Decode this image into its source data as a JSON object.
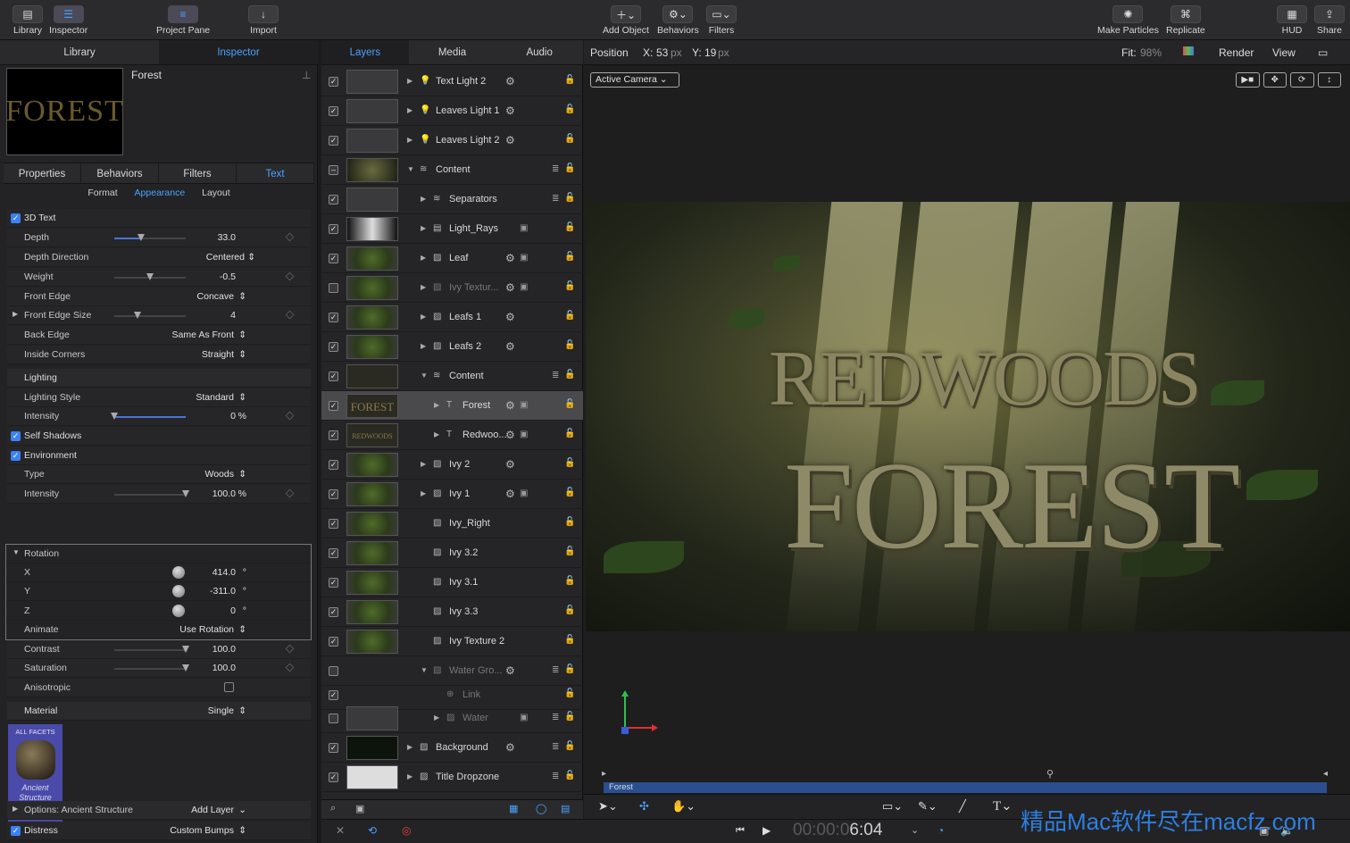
{
  "toolbar": {
    "library": "Library",
    "inspector": "Inspector",
    "project_pane": "Project Pane",
    "import": "Import",
    "add_object": "Add Object",
    "behaviors": "Behaviors",
    "filters": "Filters",
    "make_particles": "Make Particles",
    "replicate": "Replicate",
    "hud": "HUD",
    "share": "Share"
  },
  "left": {
    "tabs": [
      "Library",
      "Inspector"
    ],
    "object_name": "Forest",
    "thumb_text": "FOREST",
    "subtabs": [
      "Properties",
      "Behaviors",
      "Filters",
      "Text"
    ],
    "format_tabs": [
      "Format",
      "Appearance",
      "Layout"
    ],
    "rows": {
      "three_d_text": "3D Text",
      "depth": "Depth",
      "depth_val": "33.0",
      "depth_dir": "Depth Direction",
      "depth_dir_val": "Centered",
      "weight": "Weight",
      "weight_val": "-0.5",
      "front_edge": "Front Edge",
      "front_edge_val": "Concave",
      "front_edge_size": "Front Edge Size",
      "front_edge_size_val": "4",
      "back_edge": "Back Edge",
      "back_edge_val": "Same As Front",
      "inside_corners": "Inside Corners",
      "inside_corners_val": "Straight",
      "lighting": "Lighting",
      "lighting_style": "Lighting Style",
      "lighting_style_val": "Standard",
      "intensity": "Intensity",
      "intensity_val": "0",
      "percent": "%",
      "self_shadows": "Self Shadows",
      "environment": "Environment",
      "type": "Type",
      "type_val": "Woods",
      "env_intensity": "Intensity",
      "env_intensity_val": "100.0",
      "rotation": "Rotation",
      "x": "X",
      "x_val": "414.0",
      "y": "Y",
      "y_val": "-311.0",
      "z": "Z",
      "z_val": "0",
      "degree": "°",
      "animate": "Animate",
      "animate_val": "Use Rotation",
      "contrast": "Contrast",
      "contrast_val": "100.0",
      "saturation": "Saturation",
      "saturation_val": "100.0",
      "anisotropic": "Anisotropic",
      "material": "Material",
      "material_val": "Single",
      "all_facets": "ALL FACETS",
      "swatch_name": "Ancient Structure",
      "options": "Options: Ancient Structure",
      "add_layer": "Add Layer",
      "distress": "Distress",
      "distress_val": "Custom Bumps"
    }
  },
  "layers": {
    "tabs": [
      "Layers",
      "Media",
      "Audio"
    ],
    "items": [
      {
        "name": "Text Light 2"
      },
      {
        "name": "Leaves Light 1"
      },
      {
        "name": "Leaves Light 2"
      },
      {
        "name": "Content"
      },
      {
        "name": "Separators"
      },
      {
        "name": "Light_Rays"
      },
      {
        "name": "Leaf"
      },
      {
        "name": "Ivy Textur..."
      },
      {
        "name": "Leafs 1"
      },
      {
        "name": "Leafs 2"
      },
      {
        "name": "Content"
      },
      {
        "name": "Forest",
        "thumb": "FOREST"
      },
      {
        "name": "Redwoo...",
        "thumb": "REDWOODS"
      },
      {
        "name": "Ivy 2"
      },
      {
        "name": "Ivy 1"
      },
      {
        "name": "Ivy_Right"
      },
      {
        "name": "Ivy 3.2"
      },
      {
        "name": "Ivy 3.1"
      },
      {
        "name": "Ivy 3.3"
      },
      {
        "name": "Ivy Texture 2"
      },
      {
        "name": "Water Gro..."
      },
      {
        "name": "Link"
      },
      {
        "name": "Water"
      },
      {
        "name": "Background"
      },
      {
        "name": "Title Dropzone"
      }
    ]
  },
  "viewer": {
    "position_label": "Position",
    "x_label": "X:",
    "x_val": "53",
    "y_label": "Y:",
    "y_val": "19",
    "unit": "px",
    "fit_label": "Fit:",
    "fit_val": "98%",
    "render": "Render",
    "view": "View",
    "camera": "Active Camera",
    "title_line1": "REDWOODS",
    "title_line2": "FOREST",
    "timeline_clip": "Forest",
    "timecode_dim": "00:00:0",
    "timecode_bright": "6:04"
  },
  "watermark": "精品Mac软件尽在macfz.com"
}
